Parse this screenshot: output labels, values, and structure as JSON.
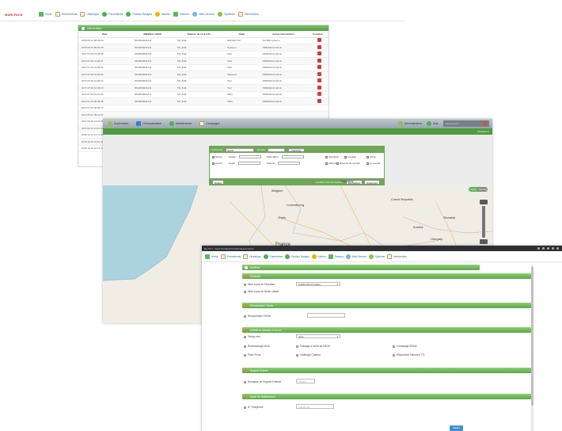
{
  "colors": {
    "accent_green": "#5aa843",
    "brand_red": "#c0392b",
    "link_blue": "#2b6cb0",
    "map_water": "#aad3df",
    "map_land": "#f0ede5"
  },
  "win1": {
    "brand": "MARLPACK",
    "nav": [
      {
        "label": "Home",
        "icon": "home-icon"
      },
      {
        "label": "Evénements",
        "icon": "document-icon"
      },
      {
        "label": "Historique",
        "icon": "document-icon"
      },
      {
        "label": "Paramètres",
        "icon": "settings-icon"
      },
      {
        "label": "Gestion Badges",
        "icon": "badge-icon"
      },
      {
        "label": "Alertes",
        "icon": "alert-icon"
      },
      {
        "label": "Retours",
        "icon": "return-icon"
      },
      {
        "label": "Web Service",
        "icon": "webservice-icon"
      },
      {
        "label": "Système",
        "icon": "system-icon"
      },
      {
        "label": "Intervention",
        "icon": "document-icon"
      }
    ],
    "panel_title": "Intervention",
    "columns": [
      "Date",
      "IMEI/Euro APAS",
      "Numéro de sé & CAL",
      "Objet",
      "Acteur intervention",
      "Fonction"
    ],
    "rows": [
      [
        "2019.09.12 08.48.09",
        "3542060001211",
        "SN_5HE",
        "DRIVER-TIP",
        "ALLIBS systeme"
      ],
      [
        "2019.06.12 09.06.05",
        "3542060001211",
        "SN_5HE",
        "Systeme",
        "PIREXECH Admin"
      ],
      [
        "2017.07.06 13.38.59",
        "3542060001211",
        "SN_5HE",
        "Flott",
        "PIREXECH Admin"
      ],
      [
        "2017.07.06 11.38.27",
        "3542060001211",
        "SN_5HE",
        "Flott",
        "PIREXECH Admin"
      ],
      [
        "2017.07.06 10.58.57",
        "3542060001211",
        "SN_5HE",
        "Flott",
        "PIREXECH Admin"
      ],
      [
        "2017.07.06 14.53.54",
        "3542060001211",
        "SN_5HE",
        "Tableaux",
        "PIREXECH Admin"
      ],
      [
        "2017.07.06 12.38.44",
        "3542060001211",
        "SN_5HE",
        "Tour",
        "PIREXECH Admin"
      ],
      [
        "2017.07.06 10.38.20",
        "3542060001211",
        "SN_5HE",
        "Tour",
        "PIREXECH Admin"
      ],
      [
        "2017.07.06 10.10.05",
        "3542060001211",
        "SN_5HE",
        "Mare",
        "PIREXECH Admin"
      ],
      [
        "2017.07.06 09.58.38",
        "3542060001211",
        "SN_5HE",
        "Mare",
        "PIREXECH Admin"
      ],
      [
        "2017.07.06 09.28.14",
        "",
        "",
        "",
        ""
      ],
      [
        "2017.05.21 09.13.57",
        "",
        "",
        "",
        ""
      ],
      [
        "2017.04.10 14.02.08",
        "",
        "",
        "",
        ""
      ],
      [
        "2017.02.12 14.12.44",
        "",
        "",
        "",
        ""
      ],
      [
        "2016.12.12 12.11.09",
        "",
        "",
        "",
        ""
      ],
      [
        "2016.12.12 12.10.10",
        "",
        "",
        "",
        ""
      ],
      [
        "2016.12.10 12.12.14",
        "",
        "",
        "",
        ""
      ]
    ]
  },
  "win2": {
    "tabs": [
      "Supervision",
      "Géolocalisation",
      "Maintenance",
      "Campagne"
    ],
    "right_tabs": [
      "Administration",
      "Aide"
    ],
    "user": "Déconnexion",
    "sub_right": "Marlpack.fr",
    "search": {
      "label": "Recherche",
      "select": "Tag/ID",
      "mode": "Actuelle",
      "button": "Chercher",
      "fields": [
        "Actuel",
        "Avertir",
        "Libellé",
        "Date début",
        "Date fin",
        "Heure",
        "Mise à jour"
      ],
      "checks": [
        "Opération",
        "Localisé",
        "Alarmés",
        "Alerte",
        "Résumé de contrat",
        "Le contrat"
      ],
      "foot_left": "Défaut",
      "foot_right": [
        "Localiser tous les résultats",
        "Réinitialiser",
        "Supprimer"
      ]
    },
    "legend": [
      {
        "color": "#4caf50",
        "count": "0"
      },
      {
        "color": "#1e6fd9",
        "count": "0"
      },
      {
        "color": "#f2b400",
        "count": "0"
      },
      {
        "color": "#e53935",
        "count": "0"
      },
      {
        "color": "#9e9e9e",
        "count": "0"
      },
      {
        "color": "#d98ac8",
        "count": "0"
      }
    ],
    "refresh": "Actualiser à 11:36:05",
    "map_toggle": [
      "Carte",
      "Satellite"
    ],
    "map_labels": [
      "Germany",
      "Belgium",
      "Luxembourg",
      "Paris",
      "France",
      "Czech Republic",
      "Austria",
      "Hungary",
      "Slovakia",
      "Switzerland",
      "Zürich"
    ]
  },
  "win3": {
    "url": "file:///C:/ - https://marlpack.fr/admin/parametres",
    "nav": [
      {
        "label": "Home",
        "icon": "home-icon"
      },
      {
        "label": "Evénements",
        "icon": "document-icon"
      },
      {
        "label": "Historique",
        "icon": "document-icon"
      },
      {
        "label": "Paramètres",
        "icon": "settings-icon"
      },
      {
        "label": "Gestion Badges",
        "icon": "badge-icon"
      },
      {
        "label": "Alertes",
        "icon": "alert-icon"
      },
      {
        "label": "Retours",
        "icon": "return-icon"
      },
      {
        "label": "Web Service",
        "icon": "webservice-icon"
      },
      {
        "label": "Système",
        "icon": "system-icon"
      },
      {
        "label": "Intervention",
        "icon": "document-icon"
      }
    ],
    "title": "Système",
    "sections": [
      {
        "title": "Firmware",
        "rows": [
          "Mise à jour du Firmware",
          "Mise à jour du fichier clavier"
        ],
        "dropdown": "GSDR RSI-Firmware"
      },
      {
        "title": "Récupération Fichier",
        "rows": [
          "Récupération Fichier"
        ]
      },
      {
        "title": "Activité et mesures à l'envoi",
        "rows": [
          "Temps réel",
          "Redémarrage MOA",
          "Passage à l'arrêt de l'MOA",
          "Formatage SRAM",
          "Prise Photo",
          "Calibrage Capteur",
          "Effacement Mémoire TTL"
        ],
        "dropdown": "none"
      },
      {
        "title": "Support Externe",
        "rows": [
          "Demande de Support Externe"
        ],
        "placeholder": "FR-001"
      },
      {
        "title": "Appel de Maintenance",
        "rows": [
          "N° Téléphone"
        ],
        "placeholder": "Téléphone"
      }
    ],
    "save": "Valider"
  }
}
